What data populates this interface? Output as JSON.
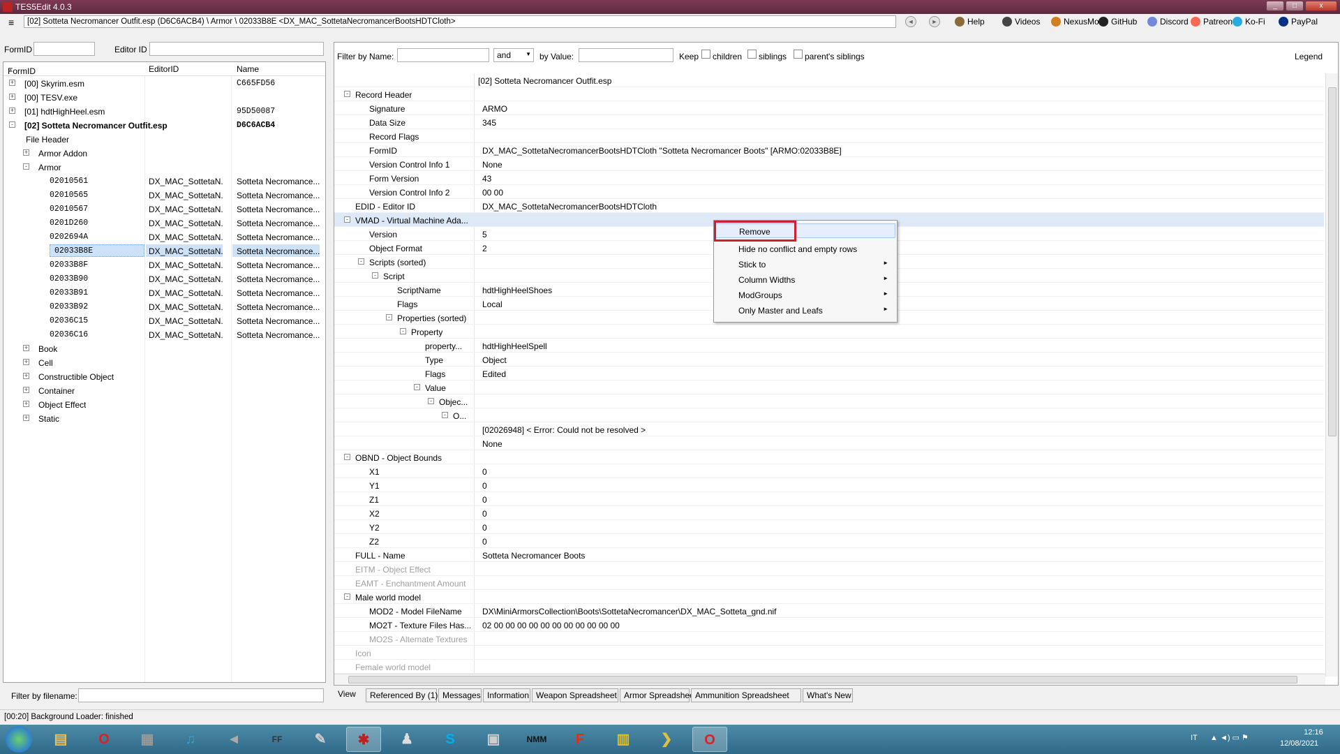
{
  "window": {
    "title": "TES5Edit 4.0.3",
    "min": "_",
    "max": "□",
    "close": "x"
  },
  "address": {
    "menu": "≡",
    "path": "[02] Sotteta Necromancer Outfit.esp (D6C6ACB4) \\ Armor \\ 02033B8E <DX_MAC_SottetaNecromancerBootsHDTCloth>"
  },
  "toolbar": {
    "back": "◄",
    "forward": "►",
    "links": [
      {
        "label": "Help",
        "color": "#8a6a3a"
      },
      {
        "label": "Videos",
        "color": "#444"
      },
      {
        "label": "NexusMods",
        "color": "#d08020"
      },
      {
        "label": "GitHub",
        "color": "#222"
      },
      {
        "label": "Discord",
        "color": "#7289da"
      },
      {
        "label": "Patreon",
        "color": "#f96854"
      },
      {
        "label": "Ko-Fi",
        "color": "#29abe0"
      },
      {
        "label": "PayPal",
        "color": "#003087"
      }
    ]
  },
  "left": {
    "formid_label": "FormID",
    "editorid_label": "Editor ID",
    "headers": {
      "formid": "FormID",
      "sort": "▲",
      "editorid": "EditorID",
      "name": "Name"
    },
    "filter_label": "Filter by filename:"
  },
  "tree": [
    {
      "indent": 0,
      "exp": "+",
      "label": "[00] Skyrim.esm",
      "editor": "",
      "name": "C665FD56",
      "mono_name": true
    },
    {
      "indent": 0,
      "exp": "+",
      "label": "[00] TESV.exe",
      "editor": "",
      "name": ""
    },
    {
      "indent": 0,
      "exp": "+",
      "label": "[01] hdtHighHeel.esm",
      "editor": "",
      "name": "95D50087",
      "mono_name": true
    },
    {
      "indent": 0,
      "exp": "-",
      "label": "[02] Sotteta Necromancer Outfit.esp",
      "editor": "",
      "name": "D6C6ACB4",
      "mono_name": true,
      "bold": true
    },
    {
      "indent": 1,
      "exp": "",
      "label": "File Header",
      "editor": "",
      "name": ""
    },
    {
      "indent": 1,
      "exp": "+",
      "label": "Armor Addon",
      "editor": "",
      "name": ""
    },
    {
      "indent": 1,
      "exp": "-",
      "label": "Armor",
      "editor": "",
      "name": ""
    },
    {
      "indent": 2,
      "exp": "",
      "label": "02010561",
      "editor": "DX_MAC_SottetaN...",
      "name": "Sotteta Necromance...",
      "mono": true
    },
    {
      "indent": 2,
      "exp": "",
      "label": "02010565",
      "editor": "DX_MAC_SottetaN...",
      "name": "Sotteta Necromance...",
      "mono": true
    },
    {
      "indent": 2,
      "exp": "",
      "label": "02010567",
      "editor": "DX_MAC_SottetaN...",
      "name": "Sotteta Necromance...",
      "mono": true
    },
    {
      "indent": 2,
      "exp": "",
      "label": "0201D260",
      "editor": "DX_MAC_SottetaN...",
      "name": "Sotteta Necromance...",
      "mono": true
    },
    {
      "indent": 2,
      "exp": "",
      "label": "0202694A",
      "editor": "DX_MAC_SottetaN...",
      "name": "Sotteta Necromance...",
      "mono": true
    },
    {
      "indent": 2,
      "exp": "",
      "label": "02033B8E",
      "editor": "DX_MAC_SottetaN...",
      "name": "Sotteta Necromance...",
      "mono": true,
      "selected": true
    },
    {
      "indent": 2,
      "exp": "",
      "label": "02033B8F",
      "editor": "DX_MAC_SottetaN...",
      "name": "Sotteta Necromance...",
      "mono": true
    },
    {
      "indent": 2,
      "exp": "",
      "label": "02033B90",
      "editor": "DX_MAC_SottetaN...",
      "name": "Sotteta Necromance...",
      "mono": true
    },
    {
      "indent": 2,
      "exp": "",
      "label": "02033B91",
      "editor": "DX_MAC_SottetaN...",
      "name": "Sotteta Necromance...",
      "mono": true
    },
    {
      "indent": 2,
      "exp": "",
      "label": "02033B92",
      "editor": "DX_MAC_SottetaN...",
      "name": "Sotteta Necromance...",
      "mono": true
    },
    {
      "indent": 2,
      "exp": "",
      "label": "02036C15",
      "editor": "DX_MAC_SottetaN...",
      "name": "Sotteta Necromance...",
      "mono": true
    },
    {
      "indent": 2,
      "exp": "",
      "label": "02036C16",
      "editor": "DX_MAC_SottetaN...",
      "name": "Sotteta Necromance...",
      "mono": true
    },
    {
      "indent": 1,
      "exp": "+",
      "label": "Book",
      "editor": "",
      "name": ""
    },
    {
      "indent": 1,
      "exp": "+",
      "label": "Cell",
      "editor": "",
      "name": ""
    },
    {
      "indent": 1,
      "exp": "+",
      "label": "Constructible Object",
      "editor": "",
      "name": ""
    },
    {
      "indent": 1,
      "exp": "+",
      "label": "Container",
      "editor": "",
      "name": ""
    },
    {
      "indent": 1,
      "exp": "+",
      "label": "Object Effect",
      "editor": "",
      "name": ""
    },
    {
      "indent": 1,
      "exp": "+",
      "label": "Static",
      "editor": "",
      "name": ""
    }
  ],
  "filter": {
    "by_name": "Filter by Name:",
    "and_value": "and",
    "by_value": "by Value:",
    "keep": "Keep",
    "children": "children",
    "siblings": "siblings",
    "parents_siblings": "parent's siblings",
    "legend": "Legend"
  },
  "grid": {
    "file_header": "[02] Sotteta Necromancer Outfit.esp",
    "rows": [
      {
        "indent": 0,
        "exp": "-",
        "key": "Record Header",
        "value": ""
      },
      {
        "indent": 1,
        "exp": "",
        "key": "Signature",
        "value": "ARMO"
      },
      {
        "indent": 1,
        "exp": "",
        "key": "Data Size",
        "value": "345"
      },
      {
        "indent": 1,
        "exp": "",
        "key": "Record Flags",
        "value": ""
      },
      {
        "indent": 1,
        "exp": "",
        "key": "FormID",
        "value": "DX_MAC_SottetaNecromancerBootsHDTCloth \"Sotteta Necromancer Boots\" [ARMO:02033B8E]"
      },
      {
        "indent": 1,
        "exp": "",
        "key": "Version Control Info 1",
        "value": "None"
      },
      {
        "indent": 1,
        "exp": "",
        "key": "Form Version",
        "value": "43"
      },
      {
        "indent": 1,
        "exp": "",
        "key": "Version Control Info 2",
        "value": "00 00"
      },
      {
        "indent": 0,
        "exp": "",
        "key": "EDID - Editor ID",
        "value": "DX_MAC_SottetaNecromancerBootsHDTCloth"
      },
      {
        "indent": 0,
        "exp": "-",
        "key": "VMAD - Virtual Machine Ada...",
        "value": "",
        "hl": true
      },
      {
        "indent": 1,
        "exp": "",
        "key": "Version",
        "value": "5"
      },
      {
        "indent": 1,
        "exp": "",
        "key": "Object Format",
        "value": "2"
      },
      {
        "indent": 1,
        "exp": "-",
        "key": "Scripts (sorted)",
        "value": ""
      },
      {
        "indent": 2,
        "exp": "-",
        "key": "Script",
        "value": ""
      },
      {
        "indent": 3,
        "exp": "",
        "key": "ScriptName",
        "value": "hdtHighHeelShoes"
      },
      {
        "indent": 3,
        "exp": "",
        "key": "Flags",
        "value": "Local"
      },
      {
        "indent": 3,
        "exp": "-",
        "key": "Properties (sorted)",
        "value": ""
      },
      {
        "indent": 4,
        "exp": "-",
        "key": "Property",
        "value": ""
      },
      {
        "indent": 5,
        "exp": "",
        "key": "property...",
        "value": "hdtHighHeelSpell"
      },
      {
        "indent": 5,
        "exp": "",
        "key": "Type",
        "value": "Object"
      },
      {
        "indent": 5,
        "exp": "",
        "key": "Flags",
        "value": "Edited"
      },
      {
        "indent": 5,
        "exp": "-",
        "key": "Value",
        "value": ""
      },
      {
        "indent": 6,
        "exp": "-",
        "key": "Objec...",
        "value": ""
      },
      {
        "indent": 7,
        "exp": "-",
        "key": "O...",
        "value": ""
      },
      {
        "indent": 8,
        "exp": "",
        "key": "",
        "value": "[02026948] < Error: Could not be resolved >"
      },
      {
        "indent": 8,
        "exp": "",
        "key": "",
        "value": "None"
      },
      {
        "indent": 0,
        "exp": "-",
        "key": "OBND - Object Bounds",
        "value": ""
      },
      {
        "indent": 1,
        "exp": "",
        "key": "X1",
        "value": "0"
      },
      {
        "indent": 1,
        "exp": "",
        "key": "Y1",
        "value": "0"
      },
      {
        "indent": 1,
        "exp": "",
        "key": "Z1",
        "value": "0"
      },
      {
        "indent": 1,
        "exp": "",
        "key": "X2",
        "value": "0"
      },
      {
        "indent": 1,
        "exp": "",
        "key": "Y2",
        "value": "0"
      },
      {
        "indent": 1,
        "exp": "",
        "key": "Z2",
        "value": "0"
      },
      {
        "indent": 0,
        "exp": "",
        "key": "FULL - Name",
        "value": "Sotteta Necromancer Boots"
      },
      {
        "indent": 0,
        "exp": "",
        "key": "EITM - Object Effect",
        "value": "",
        "gray": true
      },
      {
        "indent": 0,
        "exp": "",
        "key": "EAMT - Enchantment Amount",
        "value": "",
        "gray": true
      },
      {
        "indent": 0,
        "exp": "-",
        "key": "Male world model",
        "value": ""
      },
      {
        "indent": 1,
        "exp": "",
        "key": "MOD2 - Model FileName",
        "value": "DX\\MiniArmorsCollection\\Boots\\SottetaNecromancer\\DX_MAC_Sotteta_gnd.nif"
      },
      {
        "indent": 1,
        "exp": "",
        "key": "MO2T - Texture Files Has...",
        "value": "02 00 00 00 00 00 00 00 00 00 00 00"
      },
      {
        "indent": 1,
        "exp": "",
        "key": "MO2S - Alternate Textures",
        "value": "",
        "gray": true
      },
      {
        "indent": 0,
        "exp": "",
        "key": "Icon",
        "value": "",
        "gray": true
      },
      {
        "indent": 0,
        "exp": "",
        "key": "Female world model",
        "value": "",
        "gray": true
      }
    ]
  },
  "context_menu": {
    "items": [
      {
        "label": "Remove",
        "submenu": false
      },
      {
        "label": "Hide no conflict and empty rows",
        "submenu": false
      },
      {
        "label": "Stick to",
        "submenu": true
      },
      {
        "label": "Column Widths",
        "submenu": true
      },
      {
        "label": "ModGroups",
        "submenu": true
      },
      {
        "label": "Only Master and Leafs",
        "submenu": true
      }
    ]
  },
  "tabs": [
    "View",
    "Referenced By (1)",
    "Messages",
    "Information",
    "Weapon Spreadsheet",
    "Armor Spreadsheet",
    "Ammunition Spreadsheet",
    "What's New"
  ],
  "status": "[00:20] Background Loader: finished",
  "taskbar": {
    "items": [
      {
        "name": "explorer",
        "glyph": "▤",
        "color": "#e8c060"
      },
      {
        "name": "opera",
        "glyph": "O",
        "color": "#e02020"
      },
      {
        "name": "film",
        "glyph": "▦",
        "color": "#999"
      },
      {
        "name": "music",
        "glyph": "♫",
        "color": "#30a0e0"
      },
      {
        "name": "speaker",
        "glyph": "◄",
        "color": "#aaa"
      },
      {
        "name": "ffdec",
        "glyph": "FF",
        "color": "#333"
      },
      {
        "name": "pen",
        "glyph": "✎",
        "color": "#ccc"
      },
      {
        "name": "tes5edit",
        "glyph": "✱",
        "color": "#c02020",
        "active": true
      },
      {
        "name": "users",
        "glyph": "♟",
        "color": "#ddd"
      },
      {
        "name": "skype",
        "glyph": "S",
        "color": "#00aff0"
      },
      {
        "name": "window",
        "glyph": "▣",
        "color": "#ccc"
      },
      {
        "name": "nmm",
        "glyph": "NMM",
        "color": "#111"
      },
      {
        "name": "f-app",
        "glyph": "F",
        "color": "#e03010"
      },
      {
        "name": "calendar",
        "glyph": "▥",
        "color": "#e0c020"
      },
      {
        "name": "terminal",
        "glyph": "❯",
        "color": "#e0c040"
      },
      {
        "name": "opera2",
        "glyph": "O",
        "color": "#e02020",
        "active": true
      }
    ],
    "lang": "IT",
    "time": "12:16",
    "date": "12/08/2021"
  }
}
